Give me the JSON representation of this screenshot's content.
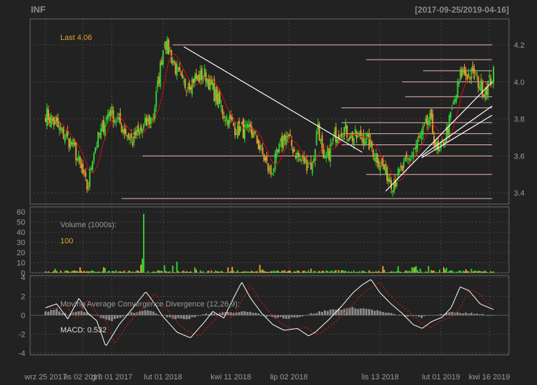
{
  "header": {
    "symbol": "INF",
    "date_range": "[2017-09-25/2019-04-16]"
  },
  "colors": {
    "background": "#222222",
    "panel_border": "#6a6a6a",
    "grid": "#444444",
    "text": "#9a9a9a",
    "up": "#33cc33",
    "down": "#e0a030",
    "sma": "#d01010",
    "trendline": "#ffffff",
    "support": "#f0b8b8",
    "volume_label": "#e0a030",
    "macd_line": "#ffffff",
    "signal_line": "#d01010",
    "histogram": "#8a8a8a"
  },
  "chart_data": [
    {
      "type": "candlestick",
      "panel": "price",
      "annotation_label": "Last 4.06",
      "last": 4.06,
      "ylim": [
        3.34,
        4.34
      ],
      "y_ticks": [
        3.4,
        3.6,
        3.8,
        4.0,
        4.2
      ],
      "x_tick_labels": [
        "wrz 25 2017",
        "lis 02 2017",
        "gru 01 2017",
        "lut 01 2018",
        "kwi 11 2018",
        "lip 02 2018",
        "lis 13 2018",
        "lut 01 2019",
        "kwi 16 2019"
      ],
      "x_tick_index": [
        0,
        27,
        48,
        85,
        134,
        176,
        242,
        286,
        321
      ],
      "n_bars": 325,
      "close": [
        3.83,
        3.81,
        3.79,
        3.74,
        3.71,
        3.7,
        3.76,
        3.8,
        3.72,
        3.66,
        3.63,
        3.66,
        3.61,
        3.63,
        3.61,
        3.57,
        3.51,
        3.39,
        3.37,
        3.54,
        3.61,
        3.62,
        3.66,
        3.67,
        3.75,
        3.71,
        3.72,
        3.8,
        3.83,
        3.76,
        3.71,
        3.72,
        3.77,
        3.84,
        3.83,
        3.86,
        3.85,
        3.92,
        3.99,
        4.01,
        4.1,
        4.14,
        4.07,
        4.02,
        3.97,
        3.95,
        3.96,
        3.95,
        3.92,
        3.93,
        3.9,
        3.92,
        3.98,
        4.0,
        4.04,
        4.03,
        3.97,
        3.94,
        3.91,
        3.9,
        3.91,
        3.94,
        3.94,
        3.89,
        3.82,
        3.78,
        3.72,
        3.69,
        3.7,
        3.7,
        3.65,
        3.68,
        3.71,
        3.74,
        3.8,
        3.82,
        3.79,
        3.72,
        3.75,
        3.69,
        3.63,
        3.66,
        3.7,
        3.67,
        3.68,
        3.7
      ],
      "support_levels": [
        3.37,
        3.5,
        3.6,
        3.66,
        3.72,
        3.78,
        3.86,
        3.92,
        4.0,
        4.06,
        4.12,
        4.2
      ],
      "trendlines": [
        {
          "from": [
            100,
            4.19
          ],
          "to": [
            229,
            3.62
          ]
        },
        {
          "from": [
            246,
            3.41
          ],
          "to": [
            323,
            4.0
          ]
        },
        {
          "from": [
            272,
            3.6
          ],
          "to": [
            323,
            3.87
          ]
        },
        {
          "from": [
            272,
            3.59
          ],
          "to": [
            323,
            3.82
          ]
        }
      ]
    },
    {
      "type": "bar",
      "panel": "volume",
      "title": "Volume (1000s):",
      "value_label": "100",
      "current": 100,
      "ylim": [
        0,
        65
      ],
      "y_ticks": [
        0,
        10,
        20,
        30,
        40,
        50,
        60
      ]
    },
    {
      "type": "line",
      "panel": "macd",
      "title": "Moving Average Convergence Divergence (12,26,9):",
      "value_label": "MACD: 0.532",
      "macd": 0.532,
      "ylim": [
        -4.2,
        4.2
      ],
      "y_ticks": [
        -4,
        -2,
        0,
        2,
        4
      ],
      "macd_anchors": [
        [
          20,
          0.8
        ],
        [
          30,
          1.2
        ],
        [
          40,
          -0.4
        ],
        [
          50,
          1.8
        ],
        [
          58,
          0.2
        ],
        [
          66,
          -0.6
        ],
        [
          74,
          -3.3
        ],
        [
          86,
          -1.0
        ],
        [
          100,
          1.0
        ],
        [
          110,
          2.5
        ],
        [
          118,
          1.2
        ],
        [
          125,
          -0.1
        ],
        [
          138,
          -1.8
        ],
        [
          150,
          -2.4
        ],
        [
          162,
          -0.8
        ],
        [
          170,
          0.4
        ],
        [
          180,
          -0.3
        ],
        [
          186,
          1.2
        ],
        [
          196,
          3.5
        ],
        [
          204,
          1.8
        ],
        [
          214,
          0.2
        ],
        [
          224,
          -1.0
        ],
        [
          234,
          -1.6
        ],
        [
          246,
          -1.4
        ],
        [
          256,
          -2.2
        ],
        [
          262,
          -1.8
        ],
        [
          274,
          -0.5
        ],
        [
          286,
          1.0
        ],
        [
          296,
          2.4
        ],
        [
          304,
          3.2
        ],
        [
          312,
          3.8
        ],
        [
          320,
          2.4
        ],
        [
          330,
          1.2
        ],
        [
          340,
          0.2
        ],
        [
          350,
          -1.0
        ],
        [
          358,
          -1.4
        ],
        [
          366,
          -0.7
        ],
        [
          376,
          -0.2
        ],
        [
          384,
          0.8
        ],
        [
          392,
          3.0
        ],
        [
          400,
          2.6
        ],
        [
          410,
          1.2
        ],
        [
          422,
          0.6
        ]
      ],
      "hist_anchors": [
        [
          20,
          0.3
        ],
        [
          30,
          0.6
        ],
        [
          40,
          0.0
        ],
        [
          50,
          0.5
        ],
        [
          60,
          0.1
        ],
        [
          70,
          -0.2
        ],
        [
          80,
          -0.6
        ],
        [
          95,
          0.2
        ],
        [
          110,
          0.6
        ],
        [
          120,
          0.2
        ],
        [
          135,
          -0.3
        ],
        [
          150,
          -0.4
        ],
        [
          162,
          0.1
        ],
        [
          175,
          0.2
        ],
        [
          190,
          0.3
        ],
        [
          200,
          0.5
        ],
        [
          212,
          0.1
        ],
        [
          225,
          -0.2
        ],
        [
          240,
          -0.3
        ],
        [
          252,
          -0.1
        ],
        [
          265,
          0.3
        ],
        [
          280,
          0.6
        ],
        [
          300,
          0.8
        ],
        [
          315,
          0.6
        ],
        [
          330,
          0.2
        ],
        [
          345,
          -0.1
        ],
        [
          360,
          -0.2
        ],
        [
          375,
          0.1
        ],
        [
          390,
          0.3
        ],
        [
          410,
          0.2
        ],
        [
          425,
          -0.1
        ]
      ]
    }
  ]
}
